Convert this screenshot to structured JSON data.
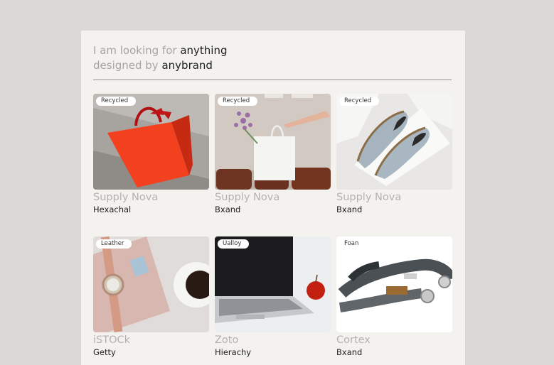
{
  "heading": {
    "prefix1": "I am looking for",
    "keyword": "anything",
    "prefix2": "designed by",
    "brand": "anybrand"
  },
  "products": [
    {
      "tag": "Recycled",
      "brand": "Supply Nova",
      "maker": "Hexachal",
      "image": "red-shopping-bag"
    },
    {
      "tag": "Recycled",
      "brand": "Supply Nova",
      "maker": "Bxand",
      "image": "white-shopping-bag-with-flowers"
    },
    {
      "tag": "Recycled",
      "brand": "Supply Nova",
      "maker": "Bxand",
      "image": "espadrille-shoes-in-box"
    },
    {
      "tag": "Leather",
      "brand": "iSTOCk",
      "maker": "Getty",
      "image": "wristwatch-and-coffee"
    },
    {
      "tag": "Ualloy",
      "brand": "Zoto",
      "maker": "Hierachy",
      "image": "laptop-and-apple"
    },
    {
      "tag": "Foan",
      "brand": "Cortex",
      "maker": "Bxand",
      "image": "camera-strap"
    }
  ]
}
